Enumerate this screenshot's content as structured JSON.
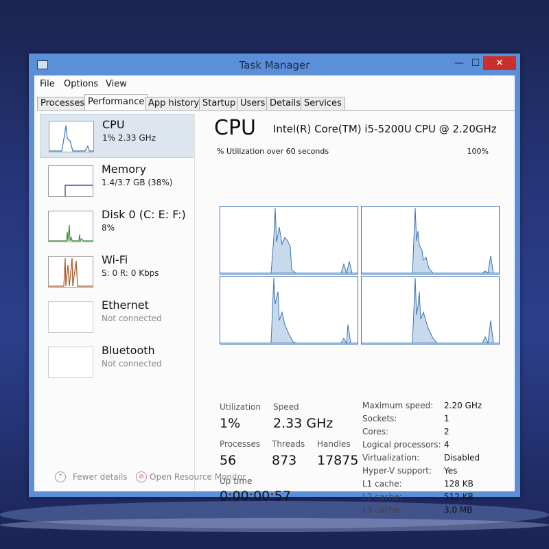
{
  "window": {
    "title": "Task Manager",
    "min_glyph": "—",
    "max_glyph": "☐",
    "close_glyph": "✕"
  },
  "menu": {
    "items": [
      "File",
      "Options",
      "View"
    ]
  },
  "tabs": [
    {
      "label": "Processes",
      "active": false
    },
    {
      "label": "Performance",
      "active": true
    },
    {
      "label": "App history",
      "active": false
    },
    {
      "label": "Startup",
      "active": false
    },
    {
      "label": "Users",
      "active": false
    },
    {
      "label": "Details",
      "active": false
    },
    {
      "label": "Services",
      "active": false
    }
  ],
  "resources": [
    {
      "name": "CPU",
      "sub": "1% 2.33 GHz",
      "selected": true,
      "thumb_color": "#3a74b3"
    },
    {
      "name": "Memory",
      "sub": "1.4/3.7 GB (38%)",
      "selected": false,
      "thumb_color": "#5a3ea8"
    },
    {
      "name": "Disk 0 (C: E: F:)",
      "sub": "8%",
      "selected": false,
      "thumb_color": "#3e8a3a"
    },
    {
      "name": "Wi-Fi",
      "sub": "S: 0 R: 0 Kbps",
      "selected": false,
      "thumb_color": "#a8572a"
    },
    {
      "name": "Ethernet",
      "sub": "Not connected",
      "selected": false,
      "thumb_color": "#999999"
    },
    {
      "name": "Bluetooth",
      "sub": "Not connected",
      "selected": false,
      "thumb_color": "#999999"
    }
  ],
  "main": {
    "title": "CPU",
    "model": "Intel(R) Core(TM) i5-5200U CPU @ 2.20GHz",
    "graph_label": "% Utilization over 60 seconds",
    "graph_max": "100%",
    "graph_color": "#3a74b3",
    "stats": {
      "utilization_label": "Utilization",
      "utilization": "1%",
      "speed_label": "Speed",
      "speed": "2.33 GHz",
      "processes_label": "Processes",
      "processes": "56",
      "threads_label": "Threads",
      "threads": "873",
      "handles_label": "Handles",
      "handles": "17875",
      "uptime_label": "Up time",
      "uptime": "0:00:00:57"
    },
    "info": [
      {
        "label": "Maximum speed:",
        "value": "2.20 GHz"
      },
      {
        "label": "Sockets:",
        "value": "1"
      },
      {
        "label": "Cores:",
        "value": "2"
      },
      {
        "label": "Logical processors:",
        "value": "4"
      },
      {
        "label": "Virtualization:",
        "value": "Disabled"
      },
      {
        "label": "Hyper-V support:",
        "value": "Yes"
      },
      {
        "label": "L1 cache:",
        "value": "128 KB"
      },
      {
        "label": "L2 cache:",
        "value": "512 KB"
      },
      {
        "label": "L3 cache:",
        "value": "3.0 MB"
      }
    ]
  },
  "footer": {
    "fewer_details": "Fewer details",
    "open_monitor": "Open Resource Monitor"
  }
}
